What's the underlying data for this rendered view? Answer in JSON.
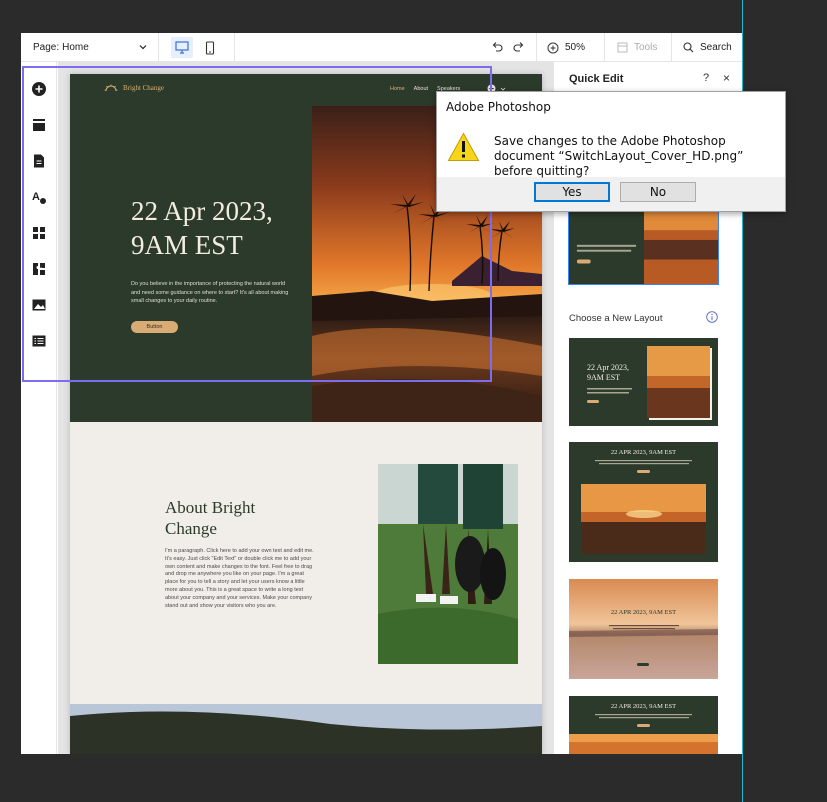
{
  "topbar": {
    "page_label": "Page:",
    "page_value": "Home",
    "zoom": "50%",
    "tools": "Tools",
    "search": "Search"
  },
  "site": {
    "logo": "Bright Change",
    "nav": [
      "Home",
      "About",
      "Speakers"
    ],
    "hero_date": "22 Apr 2023, 9AM EST",
    "hero_text": "Do you believe in the importance of protecting the natural world and need some guidance on where to start? It's all about making small changes to your daily routine.",
    "hero_button": "Button",
    "about_title": "About Bright Change",
    "about_text": "I'm a paragraph. Click here to add your own text and edit me. It's easy. Just click \"Edit Text\" or double click me to add your own content and make changes to the font. Feel free to drag and drop me anywhere you like on your page. I'm a great place for you to tell a story and let your users know a little more about you. This is a great space to write a long text about your company and your services. Make your company stand out and show your visitors who you are."
  },
  "panel": {
    "title": "Quick Edit",
    "help": "?",
    "close": "×",
    "choose_label": "Choose a New Layout",
    "layouts": [
      {
        "title": "22 Apr 2023, 9AM EST"
      },
      {
        "title": "22 APR 2023, 9AM EST"
      },
      {
        "title": "22 APR 2023, 9AM EST"
      },
      {
        "title": "22 APR 2023, 9AM EST"
      }
    ]
  },
  "dialog": {
    "title": "Adobe Photoshop",
    "message": "Save changes to the Adobe Photoshop document “SwitchLayout_Cover_HD.png” before quitting?",
    "yes": "Yes",
    "no": "No"
  },
  "colors": {
    "accent": "#7b6cf0",
    "forest": "#2b3a2a",
    "gold": "#d9ac76",
    "dialog_default": "#0078d7"
  }
}
